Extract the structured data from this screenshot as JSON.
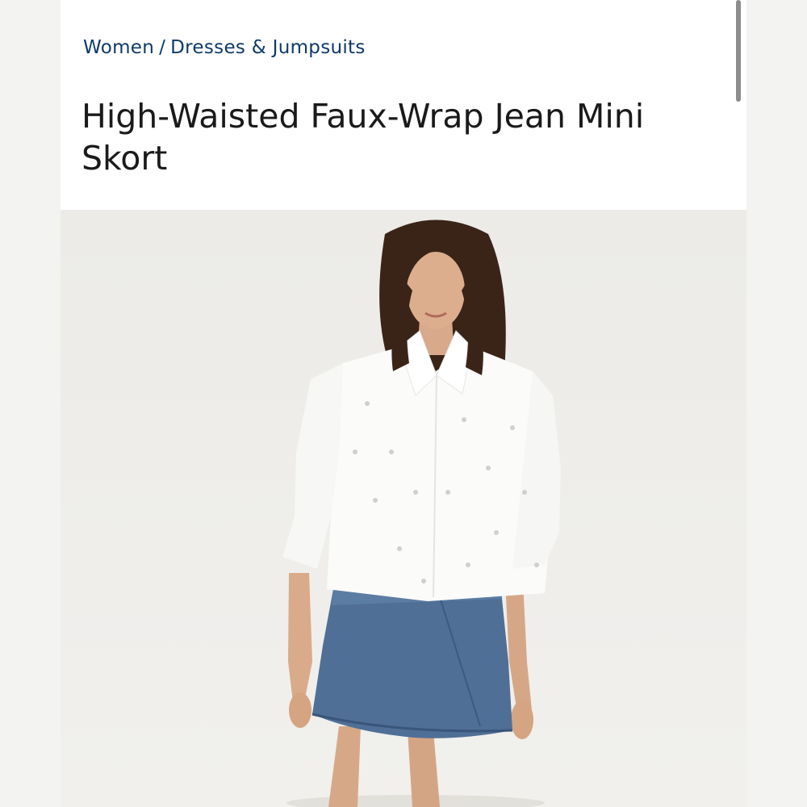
{
  "breadcrumb": {
    "items": [
      "Women",
      "Dresses & Jumpsuits"
    ],
    "separator": "/"
  },
  "product": {
    "title": "High-Waisted Faux-Wrap Jean Mini Skort"
  },
  "colors": {
    "breadcrumb_link": "#0e3a68",
    "title_text": "#1a1a1a",
    "photo_background": "#eeede9",
    "page_background": "#f3f3f1"
  }
}
